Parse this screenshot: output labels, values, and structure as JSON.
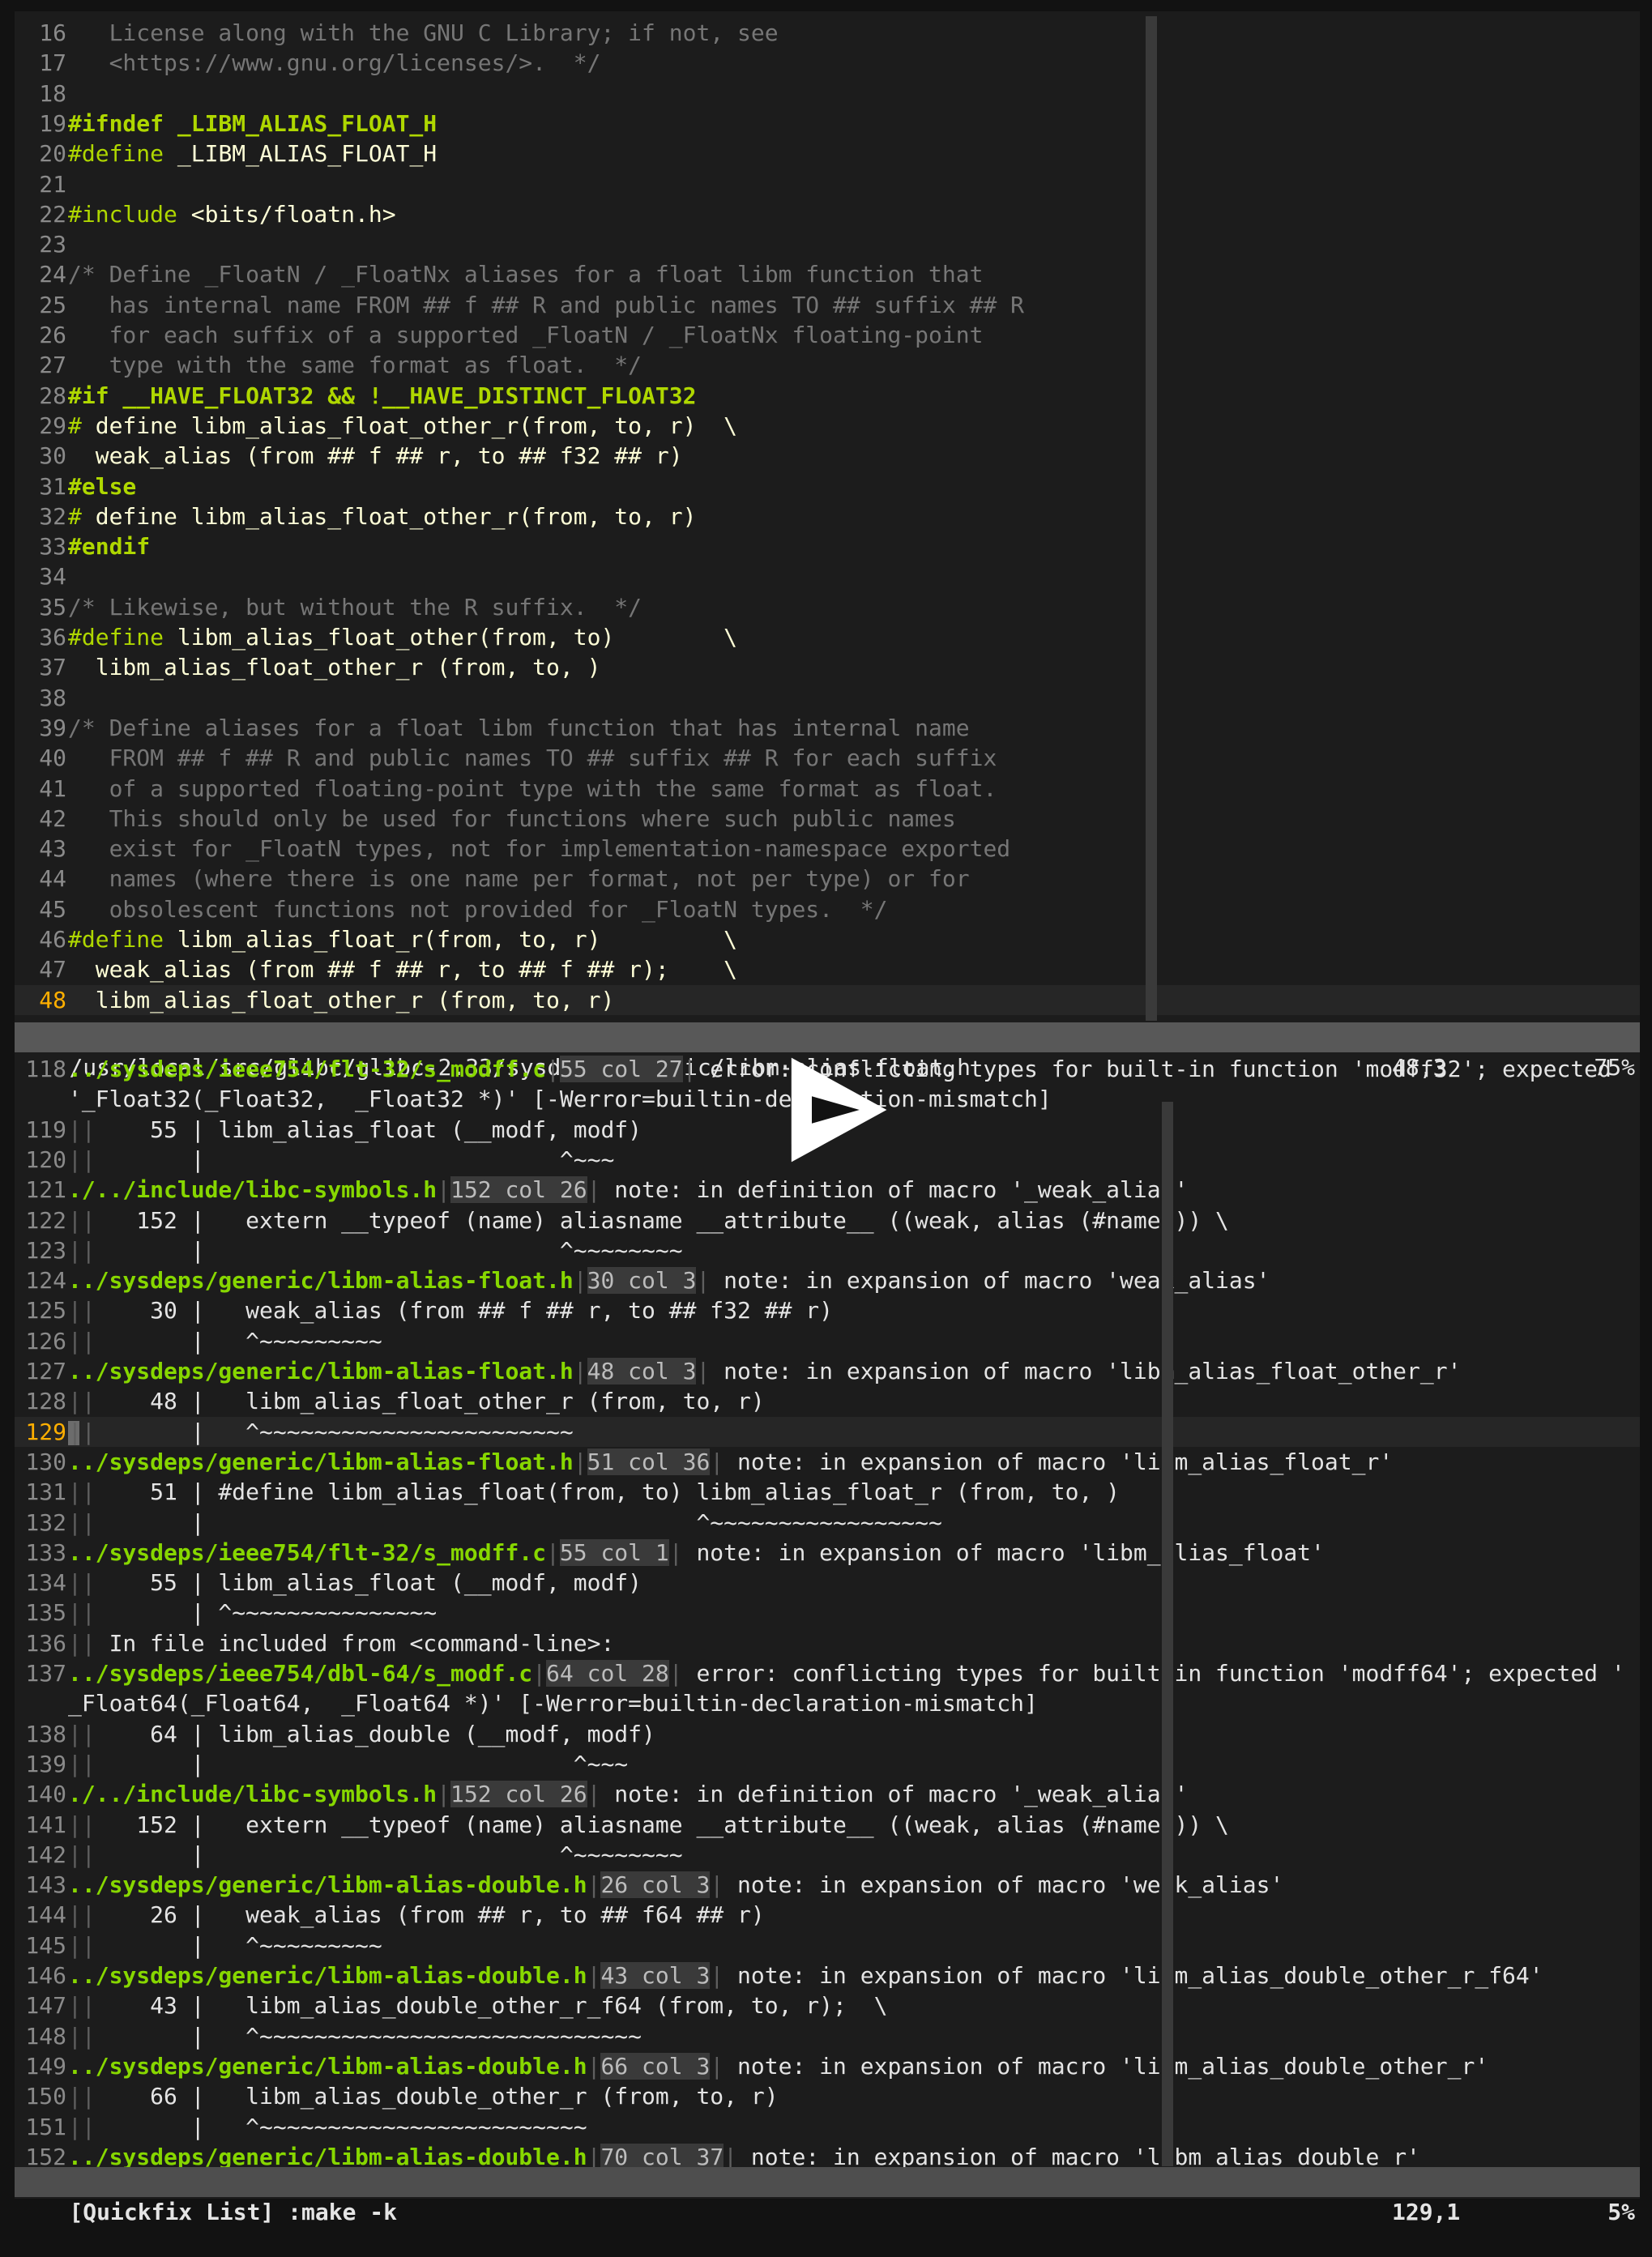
{
  "editor": {
    "lines": [
      {
        "n": "16",
        "segs": [
          [
            "comment",
            "   License along with the GNU C Library; if not, see"
          ]
        ]
      },
      {
        "n": "17",
        "segs": [
          [
            "comment",
            "   <https://www.gnu.org/licenses/>.  */"
          ]
        ]
      },
      {
        "n": "18",
        "segs": []
      },
      {
        "n": "19",
        "segs": [
          [
            "prebold",
            "#ifndef _LIBM_ALIAS_FLOAT_H"
          ]
        ]
      },
      {
        "n": "20",
        "segs": [
          [
            "pre",
            "#define"
          ],
          [
            "normal",
            " _LIBM_ALIAS_FLOAT_H"
          ]
        ]
      },
      {
        "n": "21",
        "segs": []
      },
      {
        "n": "22",
        "segs": [
          [
            "pre",
            "#include"
          ],
          [
            "normal",
            " <bits/floatn.h>"
          ]
        ]
      },
      {
        "n": "23",
        "segs": []
      },
      {
        "n": "24",
        "segs": [
          [
            "comment",
            "/* Define _FloatN / _FloatNx aliases for a float libm function that"
          ]
        ]
      },
      {
        "n": "25",
        "segs": [
          [
            "comment",
            "   has internal name FROM ## f ## R and public names TO ## suffix ## R"
          ]
        ]
      },
      {
        "n": "26",
        "segs": [
          [
            "comment",
            "   for each suffix of a supported _FloatN / _FloatNx floating-point"
          ]
        ]
      },
      {
        "n": "27",
        "segs": [
          [
            "comment",
            "   type with the same format as float.  */"
          ]
        ]
      },
      {
        "n": "28",
        "segs": [
          [
            "prebold",
            "#if __HAVE_FLOAT32 && !__HAVE_DISTINCT_FLOAT32"
          ]
        ]
      },
      {
        "n": "29",
        "segs": [
          [
            "pre",
            "#"
          ],
          [
            "normal",
            " define libm_alias_float_other_r(from, to, r)  \\"
          ]
        ]
      },
      {
        "n": "30",
        "segs": [
          [
            "normal",
            "  weak_alias (from ## f ## r, to ## f32 ## r)"
          ]
        ]
      },
      {
        "n": "31",
        "segs": [
          [
            "prebold",
            "#else"
          ]
        ]
      },
      {
        "n": "32",
        "segs": [
          [
            "pre",
            "#"
          ],
          [
            "normal",
            " define libm_alias_float_other_r(from, to, r)"
          ]
        ]
      },
      {
        "n": "33",
        "segs": [
          [
            "prebold",
            "#endif"
          ]
        ]
      },
      {
        "n": "34",
        "segs": []
      },
      {
        "n": "35",
        "segs": [
          [
            "comment",
            "/* Likewise, but without the R suffix.  */"
          ]
        ]
      },
      {
        "n": "36",
        "segs": [
          [
            "pre",
            "#define"
          ],
          [
            "normal",
            " libm_alias_float_other(from, to)        \\"
          ]
        ]
      },
      {
        "n": "37",
        "segs": [
          [
            "normal",
            "  libm_alias_float_other_r (from, to, )"
          ]
        ]
      },
      {
        "n": "38",
        "segs": []
      },
      {
        "n": "39",
        "segs": [
          [
            "comment",
            "/* Define aliases for a float libm function that has internal name"
          ]
        ]
      },
      {
        "n": "40",
        "segs": [
          [
            "comment",
            "   FROM ## f ## R and public names TO ## suffix ## R for each suffix"
          ]
        ]
      },
      {
        "n": "41",
        "segs": [
          [
            "comment",
            "   of a supported floating-point type with the same format as float."
          ]
        ]
      },
      {
        "n": "42",
        "segs": [
          [
            "comment",
            "   This should only be used for functions where such public names"
          ]
        ]
      },
      {
        "n": "43",
        "segs": [
          [
            "comment",
            "   exist for _FloatN types, not for implementation-namespace exported"
          ]
        ]
      },
      {
        "n": "44",
        "segs": [
          [
            "comment",
            "   names (where there is one name per format, not per type) or for"
          ]
        ]
      },
      {
        "n": "45",
        "segs": [
          [
            "comment",
            "   obsolescent functions not provided for _FloatN types.  */"
          ]
        ]
      },
      {
        "n": "46",
        "segs": [
          [
            "pre",
            "#define"
          ],
          [
            "normal",
            " libm_alias_float_r(from, to, r)         \\"
          ]
        ]
      },
      {
        "n": "47",
        "segs": [
          [
            "normal",
            "  weak_alias (from ## f ## r, to ## f ## r);    \\"
          ]
        ]
      },
      {
        "n": "48",
        "cur": true,
        "segs": [
          [
            "normal",
            "  libm_alias_float_other_r (from, to, r)"
          ]
        ]
      }
    ],
    "status": {
      "path": "/usr/local/src/glibc/glibc-2.33/sysdeps/generic/libm-alias-float.h",
      "pos": "48,3",
      "pct": "75%"
    }
  },
  "quickfix": {
    "lines": [
      {
        "n": "118",
        "file": "../sysdeps/ieee754/flt-32/s_modff.c",
        "loc": "55 col 27",
        "msg": " error: conflicting types for built-in function 'modff32'; expected"
      },
      {
        "n": "",
        "plain": "'_Float32(_Float32,  _Float32 *)' [-Werror=builtin-declaration-mismatch]"
      },
      {
        "n": "119",
        "bars": "||",
        "text": "    55 | libm_alias_float (__modf, modf)"
      },
      {
        "n": "120",
        "bars": "||",
        "text": "       |                          ^~~~"
      },
      {
        "n": "121",
        "file": "./../include/libc-symbols.h",
        "loc": "152 col 26",
        "msg": " note: in definition of macro '_weak_alias'"
      },
      {
        "n": "122",
        "bars": "||",
        "text": "   152 |   extern __typeof (name) aliasname __attribute__ ((weak, alias (#name))) \\"
      },
      {
        "n": "123",
        "bars": "||",
        "text": "       |                          ^~~~~~~~~"
      },
      {
        "n": "124",
        "file": "../sysdeps/generic/libm-alias-float.h",
        "loc": "30 col 3",
        "msg": " note: in expansion of macro 'weak_alias'"
      },
      {
        "n": "125",
        "bars": "||",
        "text": "    30 |   weak_alias (from ## f ## r, to ## f32 ## r)"
      },
      {
        "n": "126",
        "bars": "||",
        "text": "       |   ^~~~~~~~~~"
      },
      {
        "n": "127",
        "file": "../sysdeps/generic/libm-alias-float.h",
        "loc": "48 col 3",
        "msg": " note: in expansion of macro 'libm_alias_float_other_r'"
      },
      {
        "n": "128",
        "bars": "||",
        "text": "    48 |   libm_alias_float_other_r (from, to, r)"
      },
      {
        "n": "129",
        "cur": true,
        "bars": "||",
        "text": "       |   ^~~~~~~~~~~~~~~~~~~~~~~~"
      },
      {
        "n": "130",
        "file": "../sysdeps/generic/libm-alias-float.h",
        "loc": "51 col 36",
        "msg": " note: in expansion of macro 'libm_alias_float_r'"
      },
      {
        "n": "131",
        "bars": "||",
        "text": "    51 | #define libm_alias_float(from, to) libm_alias_float_r (from, to, )"
      },
      {
        "n": "132",
        "bars": "||",
        "text": "       |                                    ^~~~~~~~~~~~~~~~~~"
      },
      {
        "n": "133",
        "file": "../sysdeps/ieee754/flt-32/s_modff.c",
        "loc": "55 col 1",
        "msg": " note: in expansion of macro 'libm_alias_float'"
      },
      {
        "n": "134",
        "bars": "||",
        "text": "    55 | libm_alias_float (__modf, modf)"
      },
      {
        "n": "135",
        "bars": "||",
        "text": "       | ^~~~~~~~~~~~~~~~"
      },
      {
        "n": "136",
        "bars": "||",
        "text": " In file included from <command-line>:"
      },
      {
        "n": "137",
        "file": "../sysdeps/ieee754/dbl-64/s_modf.c",
        "loc": "64 col 28",
        "msg": " error: conflicting types for built-in function 'modff64'; expected '"
      },
      {
        "n": "",
        "plain": "_Float64(_Float64,  _Float64 *)' [-Werror=builtin-declaration-mismatch]"
      },
      {
        "n": "138",
        "bars": "||",
        "text": "    64 | libm_alias_double (__modf, modf)"
      },
      {
        "n": "139",
        "bars": "||",
        "text": "       |                           ^~~~"
      },
      {
        "n": "140",
        "file": "./../include/libc-symbols.h",
        "loc": "152 col 26",
        "msg": " note: in definition of macro '_weak_alias'"
      },
      {
        "n": "141",
        "bars": "||",
        "text": "   152 |   extern __typeof (name) aliasname __attribute__ ((weak, alias (#name))) \\"
      },
      {
        "n": "142",
        "bars": "||",
        "text": "       |                          ^~~~~~~~~"
      },
      {
        "n": "143",
        "file": "../sysdeps/generic/libm-alias-double.h",
        "loc": "26 col 3",
        "msg": " note: in expansion of macro 'weak_alias'"
      },
      {
        "n": "144",
        "bars": "||",
        "text": "    26 |   weak_alias (from ## r, to ## f64 ## r)"
      },
      {
        "n": "145",
        "bars": "||",
        "text": "       |   ^~~~~~~~~~"
      },
      {
        "n": "146",
        "file": "../sysdeps/generic/libm-alias-double.h",
        "loc": "43 col 3",
        "msg": " note: in expansion of macro 'libm_alias_double_other_r_f64'"
      },
      {
        "n": "147",
        "bars": "||",
        "text": "    43 |   libm_alias_double_other_r_f64 (from, to, r);  \\"
      },
      {
        "n": "148",
        "bars": "||",
        "text": "       |   ^~~~~~~~~~~~~~~~~~~~~~~~~~~~~"
      },
      {
        "n": "149",
        "file": "../sysdeps/generic/libm-alias-double.h",
        "loc": "66 col 3",
        "msg": " note: in expansion of macro 'libm_alias_double_other_r'"
      },
      {
        "n": "150",
        "bars": "||",
        "text": "    66 |   libm_alias_double_other_r (from, to, r)"
      },
      {
        "n": "151",
        "bars": "||",
        "text": "       |   ^~~~~~~~~~~~~~~~~~~~~~~~~"
      },
      {
        "n": "152",
        "file": "../sysdeps/generic/libm-alias-double.h",
        "loc": "70 col 37",
        "msg": " note: in expansion of macro 'libm_alias_double_r'"
      }
    ],
    "status": {
      "title": "[Quickfix List] :make -k",
      "pos": "129,1",
      "pct": "5%"
    }
  },
  "colors": {
    "background": "#1c1c1c",
    "filename": "#87d700",
    "preproc": "#afd700",
    "comment": "#767676",
    "cursor_line_nr": "#ffaf00"
  },
  "icons": {
    "play": "asciinema-play-icon"
  }
}
